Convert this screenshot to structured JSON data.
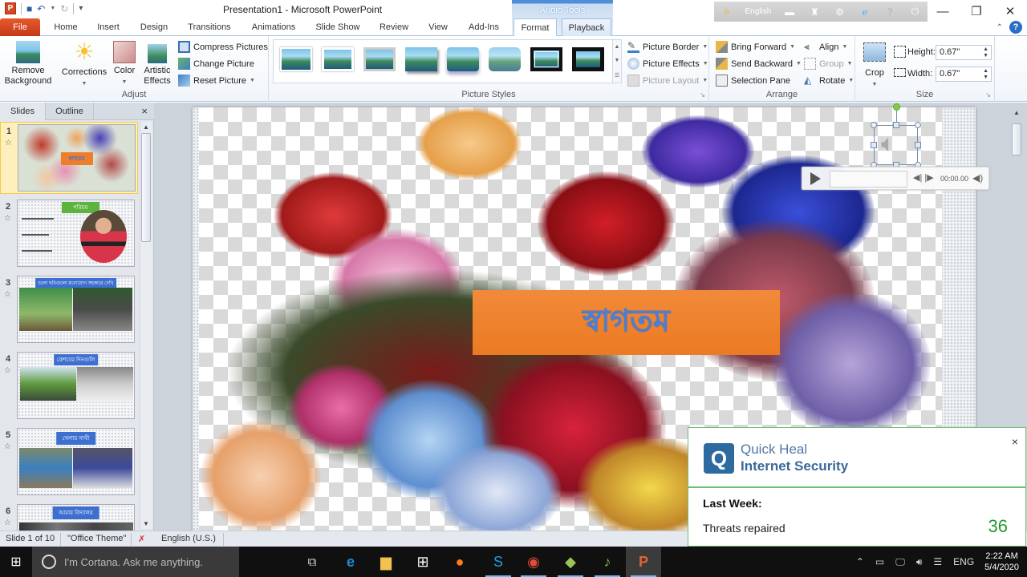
{
  "window": {
    "title": "Presentation1  -  Microsoft PowerPoint",
    "context_tab_group": "Audio Tools",
    "controls": {
      "minimize": "—",
      "restore": "❐",
      "close": "✕"
    }
  },
  "quick_access": {
    "app_icon": "P",
    "save": "💾",
    "undo": "↶",
    "redo": "↻",
    "customize": "▾"
  },
  "language_bar": {
    "language": "English"
  },
  "tabs": [
    {
      "label": "File"
    },
    {
      "label": "Home"
    },
    {
      "label": "Insert"
    },
    {
      "label": "Design"
    },
    {
      "label": "Transitions"
    },
    {
      "label": "Animations"
    },
    {
      "label": "Slide Show"
    },
    {
      "label": "Review"
    },
    {
      "label": "View"
    },
    {
      "label": "Add-Ins"
    },
    {
      "label": "Format"
    },
    {
      "label": "Playback"
    }
  ],
  "ribbon": {
    "adjust": {
      "label": "Adjust",
      "remove_background": "Remove Background",
      "corrections": "Corrections",
      "color": "Color",
      "artistic_effects": "Artistic Effects",
      "compress": "Compress Pictures",
      "change": "Change Picture",
      "reset": "Reset Picture"
    },
    "picture_styles": {
      "label": "Picture Styles",
      "border": "Picture Border",
      "effects": "Picture Effects",
      "layout": "Picture Layout"
    },
    "arrange": {
      "label": "Arrange",
      "bring_forward": "Bring Forward",
      "send_backward": "Send Backward",
      "selection_pane": "Selection Pane",
      "align": "Align",
      "group": "Group",
      "rotate": "Rotate"
    },
    "size": {
      "label": "Size",
      "crop": "Crop",
      "height_label": "Height:",
      "height_value": "0.67\"",
      "width_label": "Width:",
      "width_value": "0.67\""
    }
  },
  "slides_pane": {
    "tabs": [
      "Slides",
      "Outline"
    ],
    "close": "×",
    "slides": [
      {
        "num": "1",
        "title": "স্বাগতম"
      },
      {
        "num": "2",
        "title": "পরিচয়"
      },
      {
        "num": "3",
        "title": "চলো ছবিগুলো মনোযোগ সহকারে দেখি"
      },
      {
        "num": "4",
        "title": "কেশবের দিনগুলি"
      },
      {
        "num": "5",
        "title": "খেলার সাথী"
      },
      {
        "num": "6",
        "title": "আমার বিদ্যালয়"
      }
    ]
  },
  "slide": {
    "welcome_text": "স্বাগতম",
    "player_time": "00:00.00"
  },
  "status_bar": {
    "slide_info": "Slide 1 of 10",
    "theme": "\"Office Theme\"",
    "language": "English (U.S.)"
  },
  "taskbar": {
    "cortana_placeholder": "I'm Cortana. Ask me anything.",
    "tray_lang": "ENG",
    "time": "2:22 AM",
    "date": "5/4/2020"
  },
  "toast": {
    "brand_line1": "Quick Heal",
    "brand_line2": "Internet Security",
    "period": "Last Week:",
    "metric_label": "Threats repaired",
    "metric_value": "36",
    "accent_color": "#1f9a2d",
    "close": "×"
  }
}
